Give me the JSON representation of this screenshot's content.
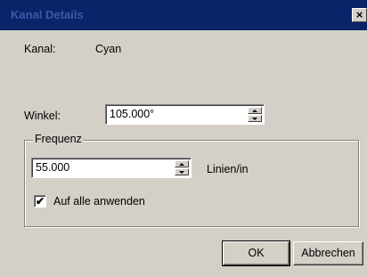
{
  "window": {
    "title": "Kanal Details",
    "close_label": "×"
  },
  "channel": {
    "label": "Kanal:",
    "value": "Cyan"
  },
  "angle": {
    "label": "Winkel:",
    "value": "105.000°"
  },
  "frequency": {
    "group_label": "Frequenz",
    "value": "55.000",
    "unit": "Linien/in",
    "apply_all_label": "Auf alle anwenden",
    "apply_all_checked": true,
    "check_mark": "✔"
  },
  "buttons": {
    "ok": "OK",
    "cancel": "Abbrechen"
  }
}
